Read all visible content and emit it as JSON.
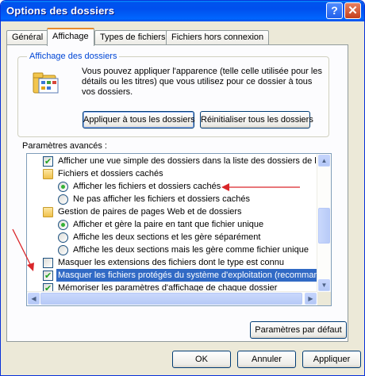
{
  "window": {
    "title": "Options des dossiers",
    "help_glyph": "?",
    "close_glyph": "✕"
  },
  "tabs": [
    {
      "label": "Général"
    },
    {
      "label": "Affichage"
    },
    {
      "label": "Types de fichiers"
    },
    {
      "label": "Fichiers hors connexion"
    }
  ],
  "group": {
    "label": "Affichage des dossiers",
    "description": "Vous pouvez appliquer l'apparence (telle celle utilisée pour les détails ou les titres) que vous utilisez pour ce dossier à tous vos dossiers.",
    "apply_all_label": "Appliquer à tous les dossiers",
    "reset_all_label": "Réinitialiser tous les dossiers"
  },
  "advanced": {
    "label": "Paramètres avancés :",
    "items": [
      {
        "type": "checkbox",
        "checked": true,
        "label": "Afficher une vue simple des dossiers dans la liste des dossiers de l'Explora"
      },
      {
        "type": "folder",
        "label": "Fichiers et dossiers cachés"
      },
      {
        "type": "radio",
        "checked": true,
        "label": "Afficher les fichiers et dossiers cachés"
      },
      {
        "type": "radio",
        "checked": false,
        "label": "Ne pas afficher les fichiers et dossiers cachés"
      },
      {
        "type": "folder",
        "label": "Gestion de paires de pages Web et de dossiers"
      },
      {
        "type": "radio",
        "checked": true,
        "label": "Afficher et gère la paire en tant que fichier unique"
      },
      {
        "type": "radio",
        "checked": false,
        "label": "Affiche les deux sections et les gère séparément"
      },
      {
        "type": "radio",
        "checked": false,
        "label": "Affiche les deux sections mais les gère comme fichier unique"
      },
      {
        "type": "checkbox",
        "checked": false,
        "label": "Masquer les extensions des fichiers dont le type est connu"
      },
      {
        "type": "checkbox",
        "checked": true,
        "selected": true,
        "label": "Masquer les fichiers protégés du système d'exploitation (recommandé)"
      },
      {
        "type": "checkbox",
        "checked": true,
        "label": "Mémoriser les paramètres d'affichage de chaque dossier"
      }
    ],
    "defaults_label": "Paramètres par défaut"
  },
  "footer": {
    "ok_label": "OK",
    "cancel_label": "Annuler",
    "apply_label": "Appliquer"
  },
  "scroll_glyphs": {
    "up": "▲",
    "down": "▼",
    "left": "◀",
    "right": "▶"
  },
  "colors": {
    "titlebar": "#0058ee",
    "selection": "#316ac5",
    "group_label": "#0046d5",
    "annotation_arrow": "#d9262a"
  }
}
